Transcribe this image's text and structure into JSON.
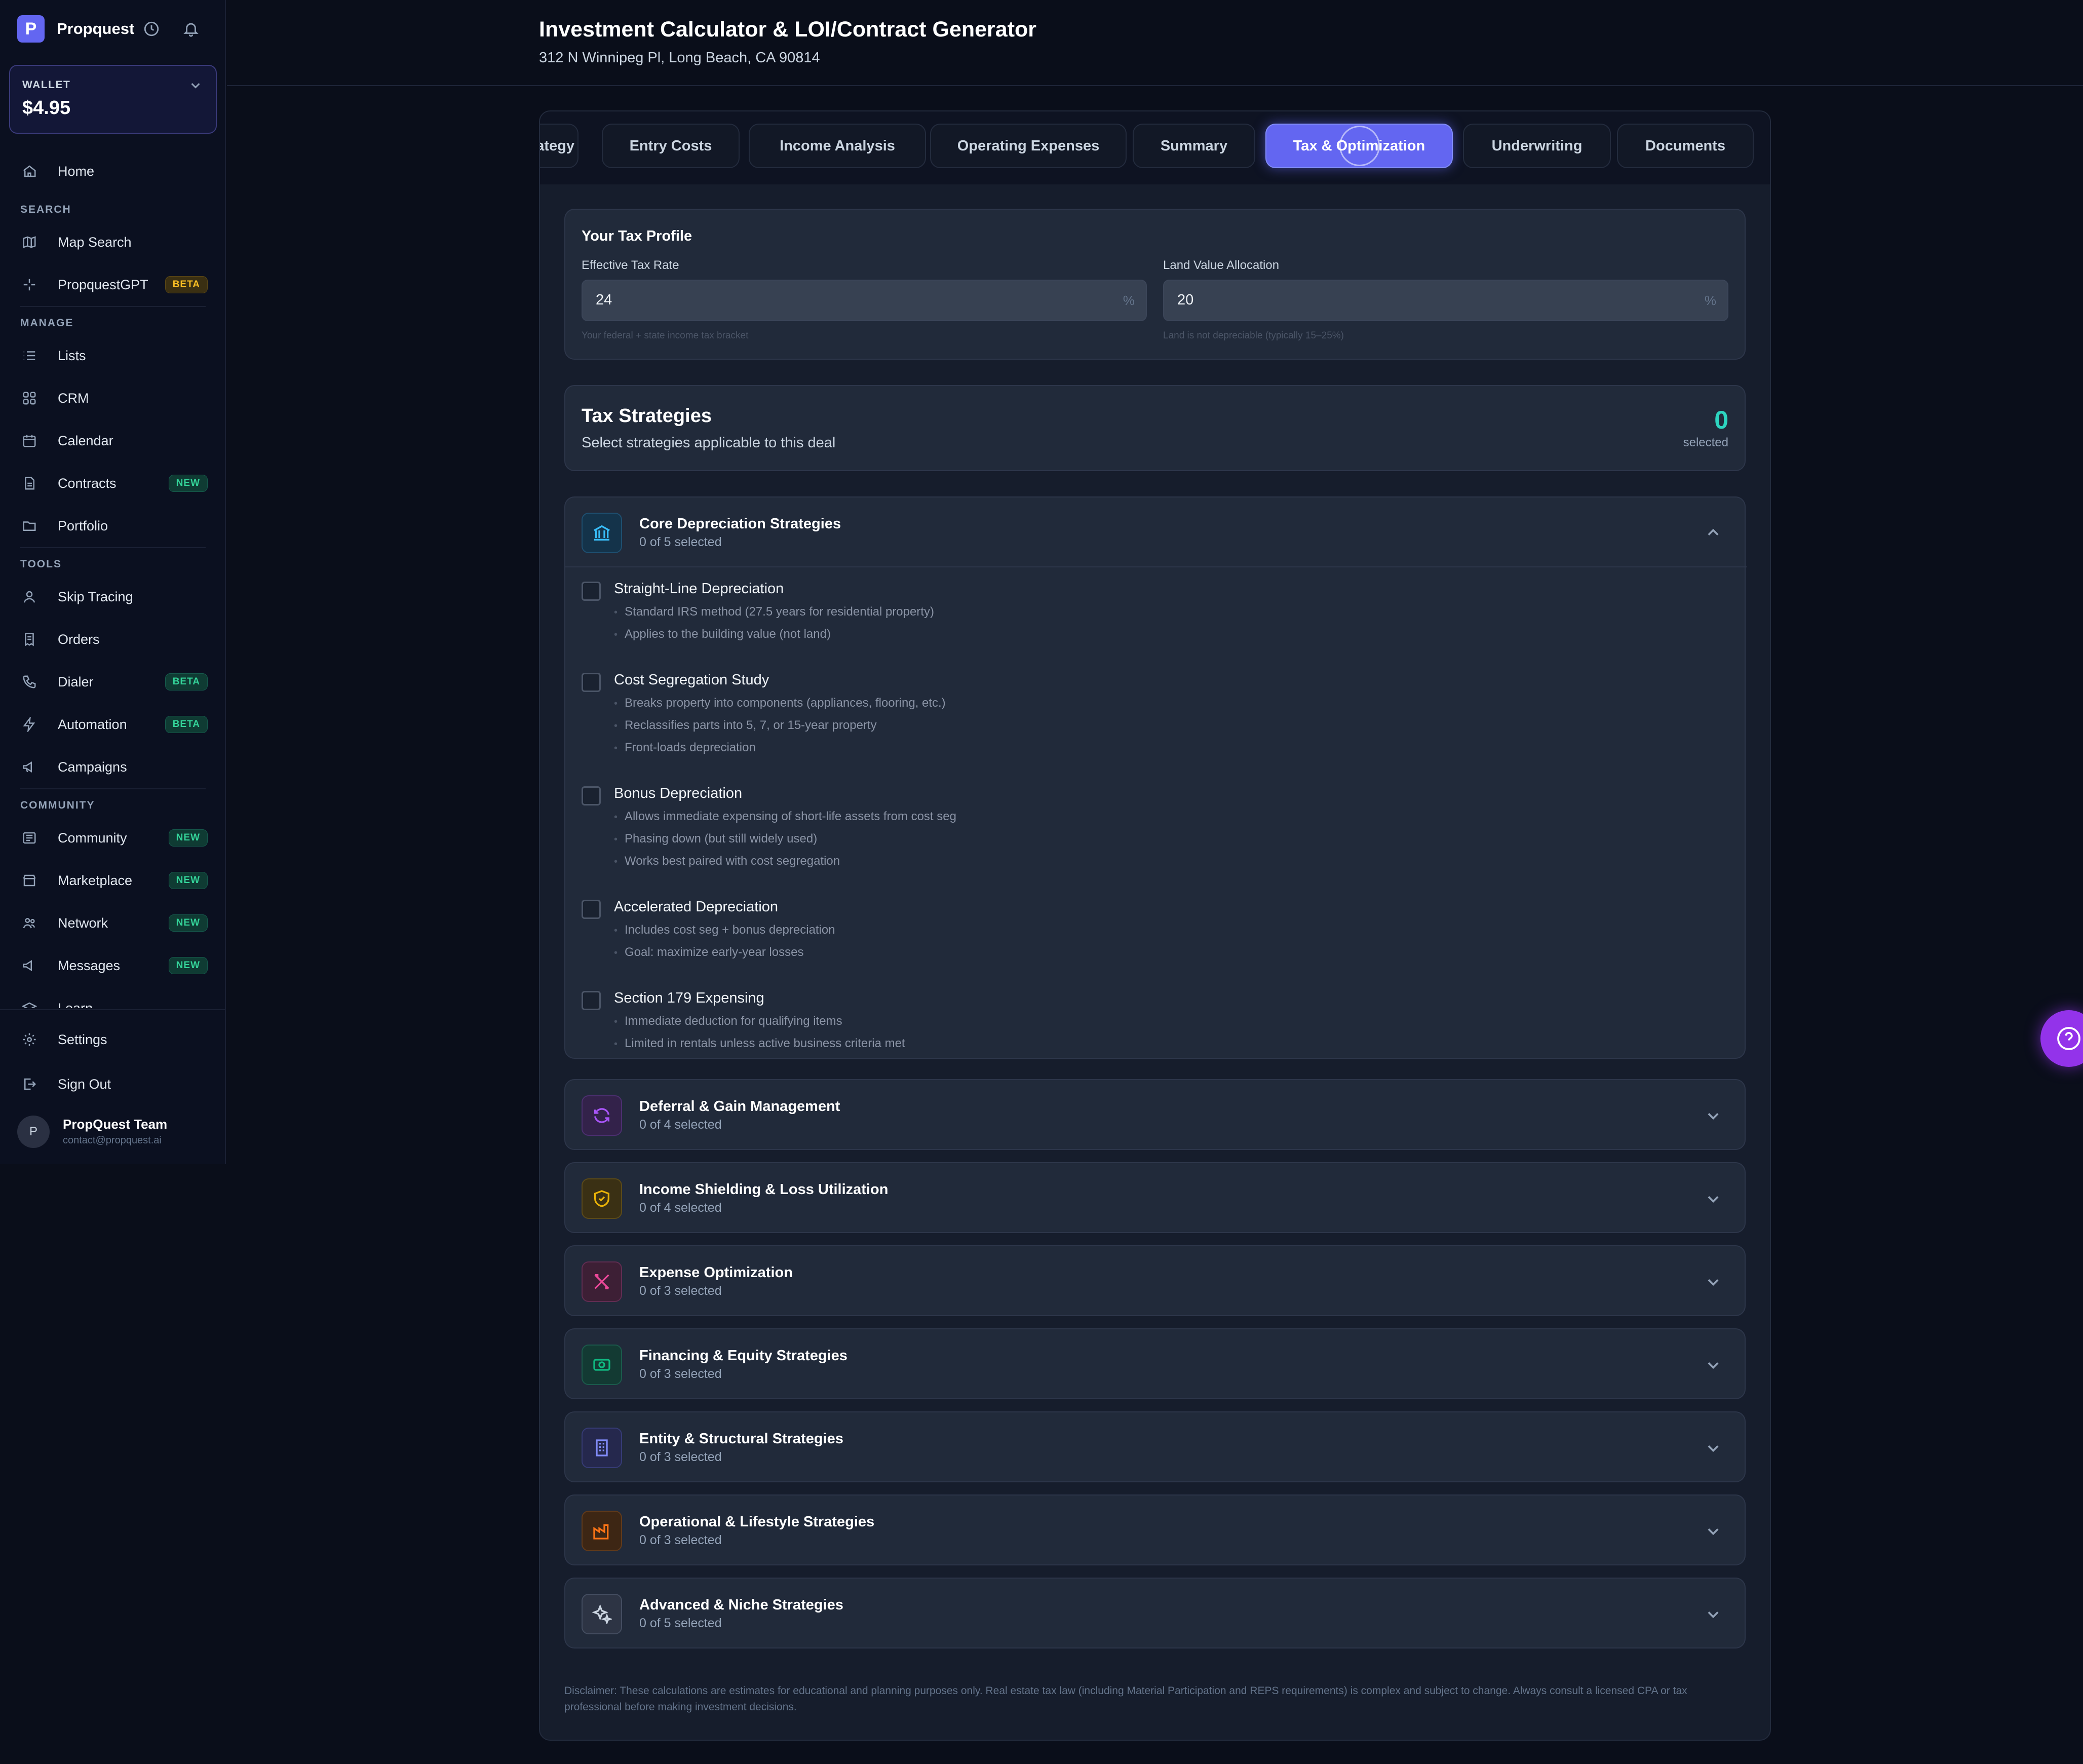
{
  "app": {
    "brand_initial": "P",
    "brand_name": "Propquest"
  },
  "wallet": {
    "label": "WALLET",
    "value": "$4.95"
  },
  "nav": {
    "home": "Home",
    "section_search": "SEARCH",
    "map_search": "Map Search",
    "propquestgpt": "PropquestGPT",
    "propquestgpt_badge": "BETA",
    "section_manage": "MANAGE",
    "lists": "Lists",
    "crm": "CRM",
    "calendar": "Calendar",
    "contracts": "Contracts",
    "contracts_badge": "NEW",
    "portfolio": "Portfolio",
    "section_tools": "TOOLS",
    "skip_tracing": "Skip Tracing",
    "orders": "Orders",
    "dialer": "Dialer",
    "dialer_badge": "BETA",
    "automation": "Automation",
    "automation_badge": "BETA",
    "campaigns": "Campaigns",
    "section_community": "COMMUNITY",
    "community": "Community",
    "community_badge": "NEW",
    "marketplace": "Marketplace",
    "marketplace_badge": "NEW",
    "network": "Network",
    "network_badge": "NEW",
    "messages": "Messages",
    "messages_badge": "NEW",
    "learn": "Learn",
    "settings": "Settings",
    "sign_out": "Sign Out"
  },
  "user": {
    "initial": "P",
    "name": "PropQuest Team",
    "email": "contact@propquest.ai"
  },
  "header": {
    "title": "Investment Calculator & LOI/Contract Generator",
    "address": "312 N Winnipeg Pl, Long Beach, CA 90814"
  },
  "tabs": [
    {
      "label": "ategy"
    },
    {
      "label": "Entry Costs"
    },
    {
      "label": "Income Analysis"
    },
    {
      "label": "Operating Expenses"
    },
    {
      "label": "Summary"
    },
    {
      "label": "Tax & Optimization"
    },
    {
      "label": "Underwriting"
    },
    {
      "label": "Documents"
    }
  ],
  "tax_profile": {
    "title": "Your Tax Profile",
    "rate_label": "Effective Tax Rate",
    "rate_value": "24",
    "rate_suffix": "%",
    "rate_hint": "Your federal + state income tax bracket",
    "land_label": "Land Value Allocation",
    "land_value": "20",
    "land_suffix": "%",
    "land_hint": "Land is not depreciable (typically 15–25%)"
  },
  "strategies": {
    "title": "Tax Strategies",
    "subtitle": "Select strategies applicable to this deal",
    "count": "0",
    "count_label": "selected"
  },
  "core": {
    "title": "Core Depreciation Strategies",
    "count": "0 of 5 selected",
    "items": [
      {
        "title": "Straight-Line Depreciation",
        "bullets": [
          "Standard IRS method (27.5 years for residential property)",
          "Applies to the building value (not land)"
        ]
      },
      {
        "title": "Cost Segregation Study",
        "bullets": [
          "Breaks property into components (appliances, flooring, etc.)",
          "Reclassifies parts into 5, 7, or 15-year property",
          "Front-loads depreciation"
        ]
      },
      {
        "title": "Bonus Depreciation",
        "bullets": [
          "Allows immediate expensing of short-life assets from cost seg",
          "Phasing down (but still widely used)",
          "Works best paired with cost segregation"
        ]
      },
      {
        "title": "Accelerated Depreciation",
        "bullets": [
          "Includes cost seg + bonus depreciation",
          "Goal: maximize early-year losses"
        ]
      },
      {
        "title": "Section 179 Expensing",
        "bullets": [
          "Immediate deduction for qualifying items",
          "Limited in rentals unless active business criteria met"
        ]
      }
    ]
  },
  "categories": [
    {
      "title": "Deferral & Gain Management",
      "count": "0 of 4 selected",
      "color": "#a855f7"
    },
    {
      "title": "Income Shielding & Loss Utilization",
      "count": "0 of 4 selected",
      "color": "#eab308"
    },
    {
      "title": "Expense Optimization",
      "count": "0 of 3 selected",
      "color": "#ec4899"
    },
    {
      "title": "Financing & Equity Strategies",
      "count": "0 of 3 selected",
      "color": "#10b981"
    },
    {
      "title": "Entity & Structural Strategies",
      "count": "0 of 3 selected",
      "color": "#6366f1"
    },
    {
      "title": "Operational & Lifestyle Strategies",
      "count": "0 of 3 selected",
      "color": "#f97316"
    },
    {
      "title": "Advanced & Niche Strategies",
      "count": "0 of 5 selected",
      "color": "#94a3b8"
    }
  ],
  "disclaimer": "Disclaimer: These calculations are estimates for educational and planning purposes only. Real estate tax law (including Material Participation and REPS requirements) is complex and subject to change. Always consult a licensed CPA or tax professional before making investment decisions.",
  "colors": {
    "accent": "#6366f1",
    "teal": "#2dd4bf",
    "help": "#9333ea"
  },
  "icons": {
    "brand": "propquest-logo",
    "history": "clock-icon",
    "notifications": "bell-icon",
    "help": "question-circle-icon"
  }
}
